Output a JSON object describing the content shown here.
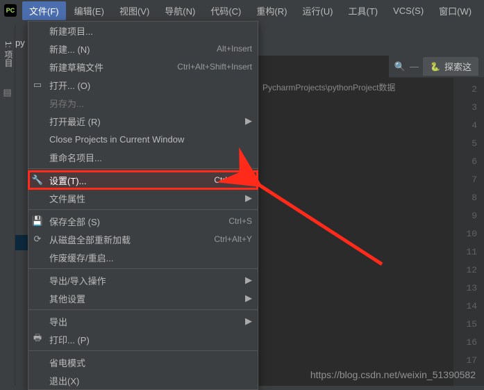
{
  "menubar": {
    "items": [
      {
        "label": "文件(F)",
        "active": true
      },
      {
        "label": "编辑(E)"
      },
      {
        "label": "视图(V)"
      },
      {
        "label": "导航(N)"
      },
      {
        "label": "代码(C)"
      },
      {
        "label": "重构(R)"
      },
      {
        "label": "运行(U)"
      },
      {
        "label": "工具(T)"
      },
      {
        "label": "VCS(S)"
      },
      {
        "label": "窗口(W)"
      }
    ]
  },
  "sidebar_tab": "1: 项目",
  "project_hint": "py",
  "dropdown": [
    {
      "type": "item",
      "icon": "",
      "label": "新建项目...",
      "shortcut": ""
    },
    {
      "type": "item",
      "icon": "",
      "label": "新建... (N)",
      "shortcut": "Alt+Insert",
      "underline": "N"
    },
    {
      "type": "item",
      "icon": "",
      "label": "新建草稿文件",
      "shortcut": "Ctrl+Alt+Shift+Insert"
    },
    {
      "type": "item",
      "icon": "folder",
      "label": "打开... (O)",
      "shortcut": "",
      "underline": "O"
    },
    {
      "type": "item",
      "icon": "",
      "label": "另存为...",
      "disabled": true
    },
    {
      "type": "item",
      "icon": "",
      "label": "打开最近 (R)",
      "submenu": true,
      "underline": "R"
    },
    {
      "type": "item",
      "icon": "",
      "label": "Close Projects in Current Window"
    },
    {
      "type": "item",
      "icon": "",
      "label": "重命名项目..."
    },
    {
      "type": "sep"
    },
    {
      "type": "item",
      "icon": "wrench",
      "label": "设置(T)...",
      "shortcut": "Ctrl+Alt+S",
      "highlight": true,
      "underline": "T"
    },
    {
      "type": "item",
      "icon": "",
      "label": "文件属性",
      "submenu": true
    },
    {
      "type": "sep"
    },
    {
      "type": "item",
      "icon": "save",
      "label": "保存全部 (S)",
      "shortcut": "Ctrl+S",
      "underline": "S"
    },
    {
      "type": "item",
      "icon": "reload",
      "label": "从磁盘全部重新加载",
      "shortcut": "Ctrl+Alt+Y"
    },
    {
      "type": "item",
      "icon": "",
      "label": "作废缓存/重启..."
    },
    {
      "type": "sep"
    },
    {
      "type": "item",
      "icon": "",
      "label": "导出/导入操作",
      "submenu": true
    },
    {
      "type": "item",
      "icon": "",
      "label": "其他设置",
      "submenu": true
    },
    {
      "type": "sep"
    },
    {
      "type": "item",
      "icon": "",
      "label": "导出",
      "submenu": true
    },
    {
      "type": "item",
      "icon": "print",
      "label": "打印... (P)",
      "underline": "P"
    },
    {
      "type": "sep"
    },
    {
      "type": "item",
      "icon": "",
      "label": "省电模式"
    },
    {
      "type": "item",
      "icon": "",
      "label": "退出(X)",
      "underline": "X"
    }
  ],
  "breadcrumb": "PycharmProjects\\pythonProject数据",
  "tab": {
    "icon": "🐍",
    "label": "探索这"
  },
  "gutter_lines": 17,
  "watermark": "https://blog.csdn.net/weixin_51390582",
  "icons": {
    "folder": "▭",
    "wrench": "🔧",
    "save": "💾",
    "reload": "⟳",
    "print": "🖶"
  }
}
